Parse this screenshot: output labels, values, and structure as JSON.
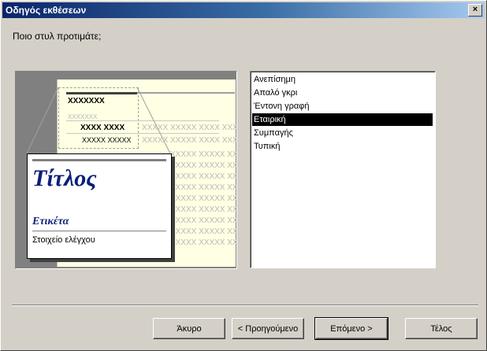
{
  "window": {
    "title": "Οδηγός εκθέσεων",
    "close_glyph": "×"
  },
  "prompt": "Ποιο στυλ προτιμάτε;",
  "preview": {
    "placeholder_bold": "XXXXXXX",
    "placeholder_faint_short": "XXXXXXX",
    "row_bold": "XXXX XXXX",
    "row_plain": "XXXXX XXXXX",
    "row_faint": "XXXXX XXXXX XXXX XXXX",
    "title": "Τίτλος",
    "label": "Ετικέτα",
    "control": "Στοιχείο ελέγχου"
  },
  "styles": {
    "items": [
      {
        "label": "Ανεπίσημη",
        "selected": false
      },
      {
        "label": "Απαλό γκρι",
        "selected": false
      },
      {
        "label": "Έντονη γραφή",
        "selected": false
      },
      {
        "label": "Εταιρική",
        "selected": true
      },
      {
        "label": "Συμπαγής",
        "selected": false
      },
      {
        "label": "Τυπική",
        "selected": false
      }
    ]
  },
  "buttons": {
    "cancel": "Άκυρο",
    "back": "< Προηγούμενο",
    "next": "Επόμενο >",
    "finish": "Τέλος"
  }
}
